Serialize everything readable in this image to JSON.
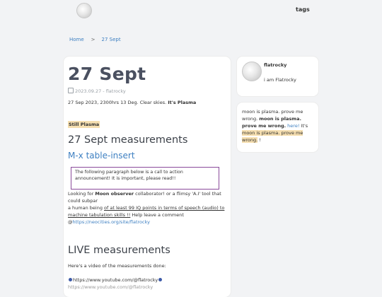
{
  "nav": {
    "tags_label": "tags"
  },
  "breadcrumb": {
    "home": "Home",
    "separator": ">",
    "current": "27 Sept"
  },
  "post": {
    "title": "27 Sept",
    "meta": "2023.09.27 - flatrocky",
    "intro_text": "27 Sep 2023, 2300hrs 13 Deg. Clear skies. It's Plasma",
    "intro_bold": "It's Plasma",
    "highlight": "Still Plasma",
    "heading_measurements": "27 Sept measurements",
    "heading_table": "M-x table-insert",
    "callout": "The following paragraph below is a call to action announcement! It is important, please read!!",
    "cta_1": "Looking for ",
    "cta_bold": "Moon observer",
    "cta_2": " collaborator! or a flimsy 'A.I' tool that could subpar",
    "cta_3": "a human being ",
    "cta_underline": "of at least 99 IQ points in terms of speech (audio) to machine tabulation skills !!",
    "cta_4": " Help leave a comment",
    "cta_5": "@",
    "cta_link": "https://neocities.org/site/flatrocky",
    "heading_live": "LIVE measurements",
    "video_intro": "Here's a video of the measurements done:",
    "video_url": "https://www.youtube.com/@flatrocky",
    "video_tail": "https://www.youtube.com/@flatrocky"
  },
  "sidebar": {
    "name": "flatrocky",
    "bio": "i am Flatrocky",
    "text_1": "moon is plasma. prove me wrong. ",
    "text_bold": "moon is plasma. prove me wrong.",
    "text_link": " here!",
    "text_2": " It's ",
    "text_mark": "moon is plasma. prove me wrong.",
    "text_end": " !"
  }
}
